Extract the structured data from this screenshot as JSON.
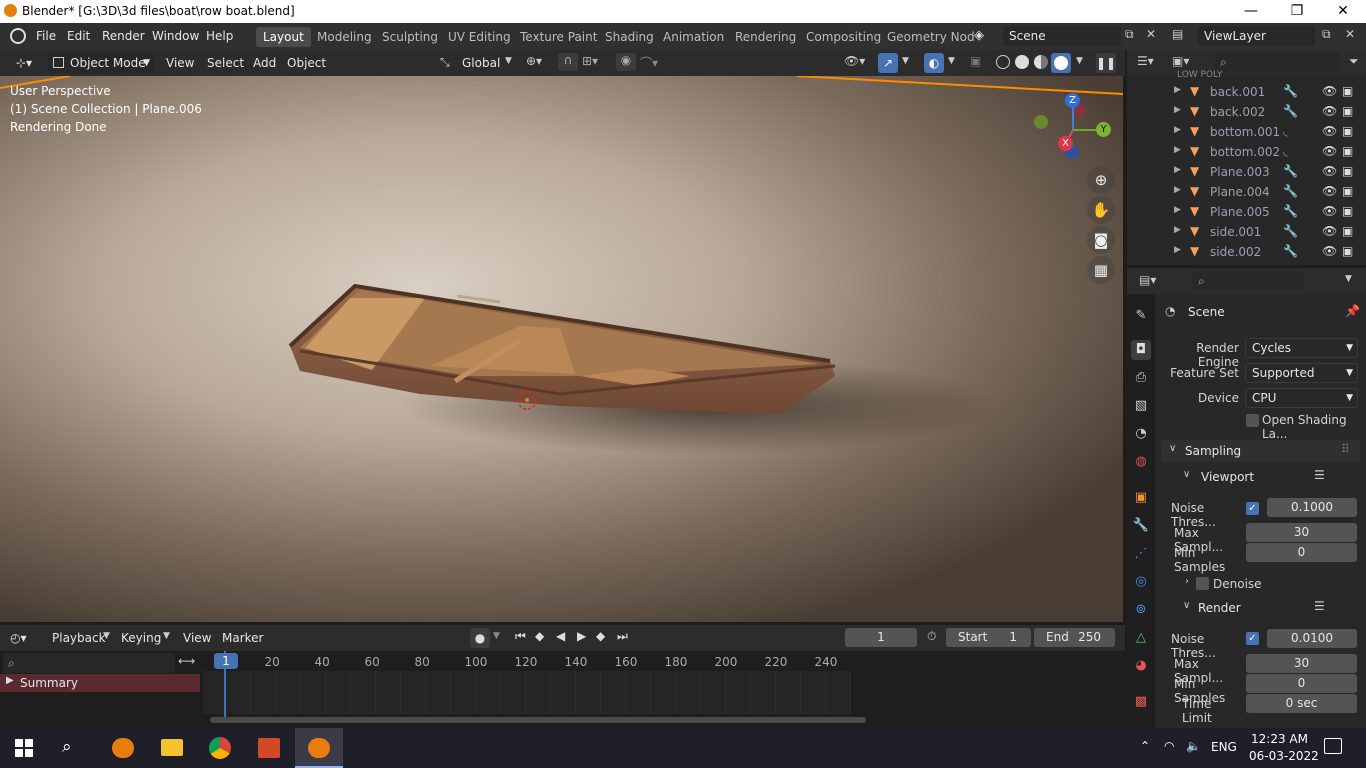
{
  "window": {
    "title": "Blender* [G:\\3D\\3d files\\boat\\row boat.blend]",
    "minimize": "—",
    "restore": "❐",
    "close": "✕"
  },
  "menubar": {
    "items": [
      "File",
      "Edit",
      "Render",
      "Window",
      "Help"
    ],
    "workspaces": [
      "Layout",
      "Modeling",
      "Sculpting",
      "UV Editing",
      "Texture Paint",
      "Shading",
      "Animation",
      "Rendering",
      "Compositing",
      "Geometry Nod"
    ],
    "active_workspace": "Layout",
    "scene": "Scene",
    "view_layer": "ViewLayer"
  },
  "viewport_header": {
    "mode": "Object Mode",
    "menus": [
      "View",
      "Select",
      "Add",
      "Object"
    ],
    "orientation": "Global"
  },
  "viewport": {
    "perspective": "User Perspective",
    "collection": "(1) Scene Collection | Plane.006",
    "status": "Rendering Done",
    "gizmo": {
      "z": "Z",
      "y": "Y",
      "x": "X"
    }
  },
  "outliner": {
    "partial_header": "LOW POLY",
    "items": [
      "back.001",
      "back.002",
      "bottom.001",
      "bottom.002",
      "Plane.003",
      "Plane.004",
      "Plane.005",
      "side.001",
      "side.002"
    ]
  },
  "properties": {
    "scene_label": "Scene",
    "render_engine": {
      "label": "Render Engine",
      "value": "Cycles"
    },
    "feature_set": {
      "label": "Feature Set",
      "value": "Supported"
    },
    "device": {
      "label": "Device",
      "value": "CPU"
    },
    "open_shading": "Open Shading La...",
    "sampling": "Sampling",
    "viewport": {
      "label": "Viewport",
      "noise_label": "Noise Thres...",
      "noise_value": "0.1000",
      "max_label": "Max Sampl...",
      "max_value": "30",
      "min_label": "Min Samples",
      "min_value": "0"
    },
    "denoise": "Denoise",
    "render": {
      "label": "Render",
      "noise_label": "Noise Thres...",
      "noise_value": "0.0100",
      "max_label": "Max Sampl...",
      "max_value": "30",
      "min_label": "Min Samples",
      "min_value": "0",
      "time_label": "Time Limit",
      "time_value": "0 sec"
    }
  },
  "timeline": {
    "menus": [
      "Playback",
      "Keying",
      "View",
      "Marker"
    ],
    "current_frame": "1",
    "start_label": "Start",
    "start_value": "1",
    "end_label": "End",
    "end_value": "250",
    "ticks": [
      "1",
      "20",
      "40",
      "60",
      "80",
      "100",
      "120",
      "140",
      "160",
      "180",
      "200",
      "220",
      "240"
    ],
    "summary": "Summary"
  },
  "taskbar": {
    "lang": "ENG",
    "time": "12:23 AM",
    "date": "06-03-2022"
  }
}
